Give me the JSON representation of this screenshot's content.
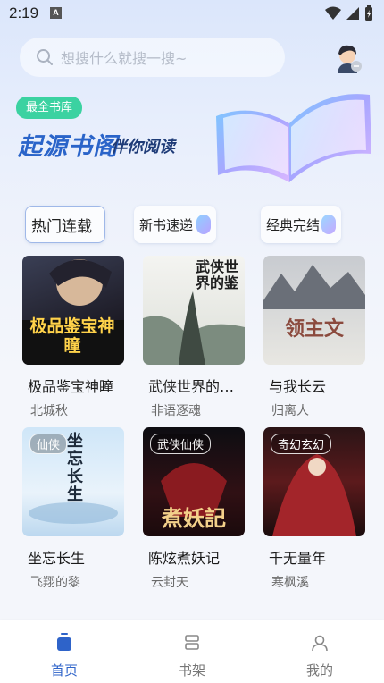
{
  "status_bar": {
    "time": "2:19",
    "notification_badge": "A"
  },
  "search": {
    "placeholder": "想搜什么就搜一搜~"
  },
  "banner": {
    "badge": "最全书库",
    "title": "起源书阁",
    "subtitle": "伴你阅读"
  },
  "categories": [
    {
      "label": "热门连载",
      "active": true
    },
    {
      "label": "新书速递",
      "active": false
    },
    {
      "label": "经典完结",
      "active": false
    }
  ],
  "books": [
    {
      "title": "极品鉴宝神瞳",
      "author": "北城秋",
      "cover_text": "极品鉴宝神瞳",
      "tag": ""
    },
    {
      "title": "武侠世界的…",
      "author": "非语逐魂",
      "cover_text": "武侠世界的鉴",
      "tag": ""
    },
    {
      "title": "与我长云",
      "author": "归离人",
      "cover_text": "领主文",
      "tag": ""
    },
    {
      "title": "坐忘长生",
      "author": "飞翔的黎",
      "cover_text": "坐忘长生",
      "tag": "仙侠"
    },
    {
      "title": "陈炫煮妖记",
      "author": "云封天",
      "cover_text": "煮妖記",
      "tag": "武侠仙侠"
    },
    {
      "title": "千无量年",
      "author": "寒枫溪",
      "cover_text": "",
      "tag": "奇幻玄幻"
    }
  ],
  "bottom_nav": [
    {
      "label": "首页",
      "icon": "home-icon",
      "active": true
    },
    {
      "label": "书架",
      "icon": "bookshelf-icon",
      "active": false
    },
    {
      "label": "我的",
      "icon": "profile-icon",
      "active": false
    }
  ],
  "colors": {
    "accent": "#2e63c9",
    "badge": "#3bd2a1",
    "title": "#2a64c9"
  }
}
